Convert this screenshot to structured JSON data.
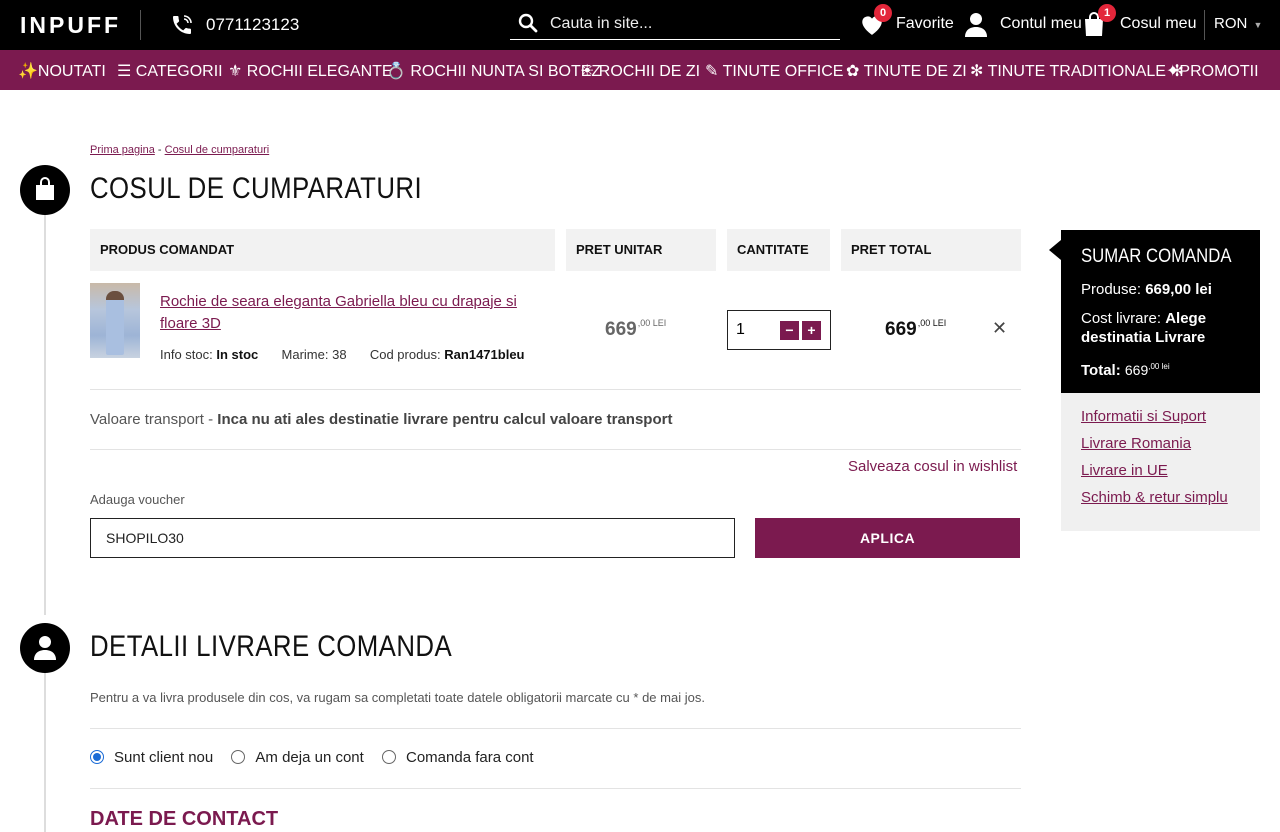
{
  "header": {
    "logo": "INPUFF",
    "phone": "0771123123",
    "search_placeholder": "Cauta in site...",
    "favorites_label": "Favorite",
    "favorites_count": "0",
    "account_label": "Contul meu",
    "cart_label": "Cosul meu",
    "cart_count": "1",
    "currency": "RON"
  },
  "nav": [
    {
      "label": "✨NOUTATI"
    },
    {
      "label": "☰ CATEGORII"
    },
    {
      "label": "⚜ ROCHII ELEGANTE"
    },
    {
      "label": "💍 ROCHII NUNTA SI BOTEZ"
    },
    {
      "label": "☀ ROCHII DE ZI"
    },
    {
      "label": "✎ TINUTE OFFICE"
    },
    {
      "label": "✿ TINUTE DE ZI"
    },
    {
      "label": "✻ TINUTE TRADITIONALE ✻"
    },
    {
      "label": "✦PROMOTII"
    }
  ],
  "breadcrumb": {
    "home": "Prima pagina",
    "separator": "-",
    "current": "Cosul de cumparaturi"
  },
  "cart": {
    "title": "COSUL DE CUMPARATURI",
    "columns": [
      "PRODUS COMANDAT",
      "PRET UNITAR",
      "CANTITATE",
      "PRET TOTAL"
    ],
    "item": {
      "name": "Rochie de seara eleganta Gabriella bleu cu drapaje si floare 3D",
      "stock_label": "Info stoc:",
      "stock_value": "In stoc",
      "size_label": "Marime:",
      "size_value": "38",
      "code_label": "Cod produs:",
      "code_value": "Ran1471bleu",
      "unit_price": "669",
      "unit_price_dec": ",00 LEI",
      "quantity": "1",
      "total_price": "669",
      "total_price_dec": ",00 LEI"
    },
    "transport_label": "Valoare transport -",
    "transport_value": "Inca nu ati ales destinatie livrare pentru calcul valoare transport",
    "wishlist_link": "Salveaza cosul in wishlist",
    "voucher_label": "Adauga voucher",
    "voucher_value": "SHOPILO30",
    "apply_label": "APLICA"
  },
  "summary": {
    "title": "SUMAR COMANDA",
    "products_label": "Produse:",
    "products_value": "669,00 lei",
    "shipping_label": "Cost livrare:",
    "shipping_value": "Alege destinatia Livrare",
    "total_label": "Total:",
    "total_value": "669",
    "total_sup": ",00 lei"
  },
  "info_links": [
    "Informatii si Suport",
    "Livrare Romania",
    "Livrare in UE",
    "Schimb & retur simplu"
  ],
  "delivery": {
    "title": "DETALII LIVRARE COMANDA",
    "description": "Pentru a va livra produsele din cos, va rugam sa completati toate datele obligatorii marcate cu * de mai jos.",
    "options": [
      "Sunt client nou",
      "Am deja un cont",
      "Comanda fara cont"
    ],
    "contact_title": "DATE DE CONTACT"
  },
  "colors": {
    "brand": "#7b1a4f",
    "topbar": "#000000",
    "badge": "#e3263a"
  }
}
